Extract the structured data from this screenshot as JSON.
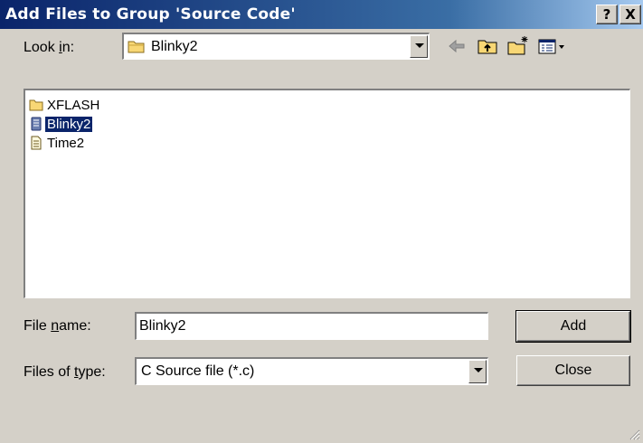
{
  "window": {
    "title": "Add Files to Group 'Source Code'",
    "help_label": "?",
    "close_label": "X"
  },
  "look_in": {
    "label_pre": "Look ",
    "label_key": "i",
    "label_post": "n:",
    "value": "Blinky2"
  },
  "toolbar": {
    "icons": [
      "back-arrow-icon",
      "up-one-level-icon",
      "new-folder-icon",
      "view-menu-icon"
    ]
  },
  "files": [
    {
      "name": "XFLASH",
      "icon": "folder-icon",
      "selected": false
    },
    {
      "name": "Blinky2",
      "icon": "project-file-icon",
      "selected": true
    },
    {
      "name": "Time2",
      "icon": "document-icon",
      "selected": false
    }
  ],
  "file_name": {
    "label_pre": "File ",
    "label_key": "n",
    "label_post": "ame:",
    "value": "Blinky2"
  },
  "file_type": {
    "label_pre": "Files of ",
    "label_key": "t",
    "label_post": "ype:",
    "value": "C Source file (*.c)"
  },
  "buttons": {
    "add": "Add",
    "close": "Close"
  },
  "colors": {
    "title_gradient_start": "#0a246a",
    "title_gradient_end": "#a6caf0",
    "dialog_bg": "#d4d0c8",
    "selection": "#0a246a"
  }
}
